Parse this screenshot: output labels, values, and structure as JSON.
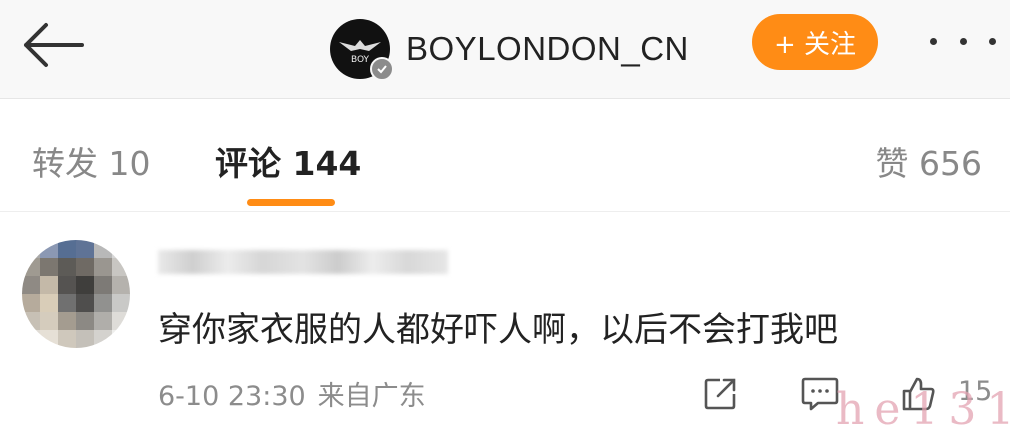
{
  "header": {
    "username": "BOYLONDON_CN",
    "avatar_text": "BOY",
    "follow_label": "+ 关注"
  },
  "tabs": {
    "repost": "转发 10",
    "comments": "评论 144",
    "likes": "赞 656"
  },
  "comment": {
    "text": "穿你家衣服的人都好吓人啊，以后不会打我吧",
    "time": "6-10 23:30",
    "source": "来自广东",
    "like_count": "15"
  },
  "watermark": "he131",
  "colors": {
    "accent": "#ff8c15",
    "text": "#222222",
    "muted": "#8c8c8c",
    "header_bg": "#f8f8f8"
  },
  "icons": {
    "back": "arrow-left-icon",
    "more": "more-dots-icon",
    "verified": "verified-badge-icon",
    "share": "share-icon",
    "reply": "comment-icon",
    "like": "thumbs-up-icon"
  }
}
